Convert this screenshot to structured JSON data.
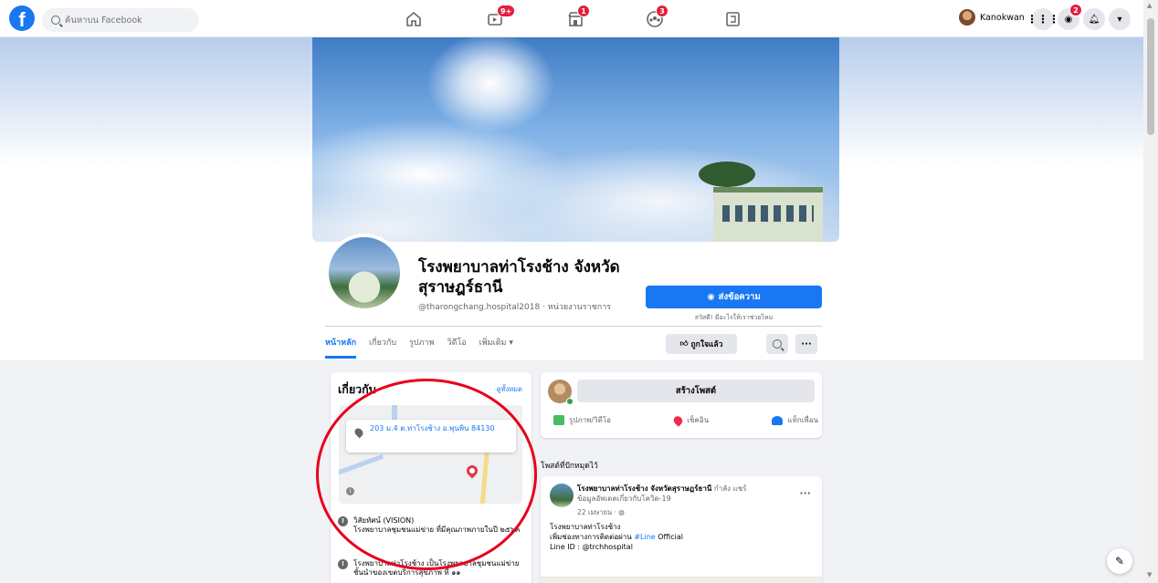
{
  "topbar": {
    "search_placeholder": "ค้นหาบน Facebook",
    "watch_badge": "9+",
    "marketplace_badge": "1",
    "groups_badge": "3",
    "messenger_badge": "2",
    "user_name": "Kanokwan"
  },
  "page": {
    "name": "โรงพยาบาลท่าโรงช้าง จังหวัดสุราษฎร์ธานี",
    "handle": "@tharongchang.hospital2018 · หน่วยงานราชการ",
    "message_button": "ส่งข้อความ",
    "message_sub": "สวัสดี! มีอะไรให้เราช่วยไหม",
    "liked_button": "ถูกใจแล้ว"
  },
  "tabs": [
    "หน้าหลัก",
    "เกี่ยวกับ",
    "รูปภาพ",
    "วิดีโอ",
    "เพิ่มเติม ▾"
  ],
  "about": {
    "title": "เกี่ยวกับ",
    "see_all": "ดูทั้งหมด",
    "address": "203 ม.4 ต.ท่าโรงช้าง อ.พุนพิน 84130",
    "vision_title": "วิสัยทัศน์ (VISION)",
    "vision_text": "โรงพยาบาลชุมชนแม่ข่าย ที่มีคุณภาพภายในปี ๒๕๖๓",
    "mission_text": "โรงพยาบาลท่าโรงช้าง เป็นโรงพยาบาลชุมชนแม่ข่ายชั้นนำของเขตบริการสุขภาพ ที่ ๑๑"
  },
  "create_post": {
    "label": "สร้างโพสต์",
    "photo_video": "รูปภาพ/วิดีโอ",
    "check_in": "เช็คอิน",
    "tag_friends": "แท็กเพื่อน"
  },
  "pinned": {
    "label": "โพสต์ที่ปักหมุดไว้",
    "author": "โรงพยาบาลท่าโรงช้าง จังหวัดสุราษฎร์ธานี",
    "action": "กำลัง",
    "action_tail": "แชร์",
    "subtitle": "ข้อมูลอัพเดตเกี่ยวกับโควิด-19",
    "time": "22 เมษายน · ",
    "line1": "โรงพยาบาลท่าโรงช้าง",
    "line2_prefix": "เพิ่มช่องทางการติดต่อผ่าน ",
    "line2_link": "#Line",
    "line2_suffix": " Official",
    "line3": "Line ID : @trchhospital"
  }
}
